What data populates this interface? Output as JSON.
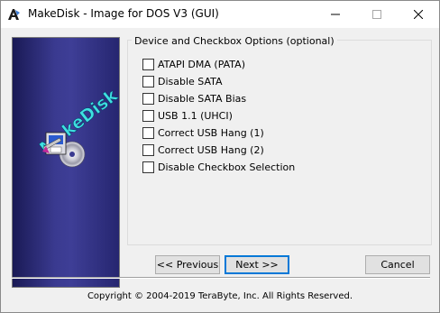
{
  "window": {
    "title": "MakeDisk - Image for DOS V3 (GUI)",
    "controls": [
      "minimize-icon",
      "maximize-icon",
      "close-icon"
    ]
  },
  "banner": {
    "text": "MakeDisk",
    "icon": "disk-program-icon"
  },
  "group": {
    "label": "Device and Checkbox Options (optional)",
    "options": [
      {
        "label": "ATAPI DMA (PATA)",
        "checked": false
      },
      {
        "label": "Disable SATA",
        "checked": false
      },
      {
        "label": "Disable SATA Bias",
        "checked": false
      },
      {
        "label": "USB 1.1 (UHCI)",
        "checked": false
      },
      {
        "label": "Correct USB Hang (1)",
        "checked": false
      },
      {
        "label": "Correct USB Hang (2)",
        "checked": false
      },
      {
        "label": "Disable Checkbox Selection",
        "checked": false
      }
    ]
  },
  "buttons": {
    "previous": "<< Previous",
    "next": "Next >>",
    "cancel": "Cancel"
  },
  "footer": {
    "copyright": "Copyright © 2004-2019 TeraByte, Inc.  All Rights Reserved."
  },
  "colors": {
    "accent": "#0078d7",
    "banner": "#3a3a90",
    "banner_text": "#3ee0e0"
  }
}
